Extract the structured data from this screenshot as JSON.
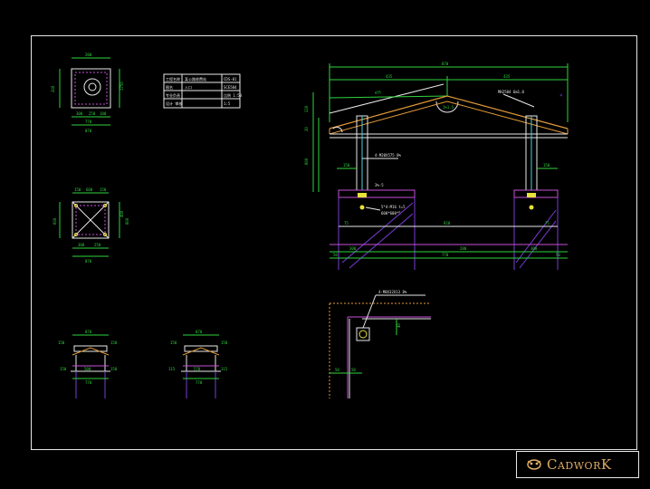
{
  "colors": {
    "background": "#000000",
    "frame": "#e6e6e6",
    "line_white": "#e8e8e8",
    "dim_green": "#2fd33c",
    "cyan": "#42d6e6",
    "magenta": "#c64fd8",
    "purple": "#7a3bd6",
    "yellow": "#e9e23a",
    "orange": "#e39a3a",
    "brand": "#e0ac63"
  },
  "logo": {
    "text": "CadworK",
    "icon": "cadwork-logo-icon"
  },
  "plan_top": {
    "top_dims": [
      "150",
      "200",
      "150"
    ],
    "mid_dims": [
      "300",
      "250",
      "180"
    ],
    "bottom_dim": "770",
    "overall": "870",
    "side_dims": [
      "150",
      "200",
      "150"
    ],
    "right_dims": [
      "250",
      "1750",
      "300"
    ]
  },
  "plan_middle": {
    "top_dims": [
      "150",
      "600",
      "150"
    ],
    "bottom_dims": [
      "300",
      "250"
    ],
    "overall": "870",
    "side_dims": [
      "150",
      "600",
      "150"
    ],
    "right_dims": [
      "400",
      "800"
    ]
  },
  "elev_left": {
    "top": "870",
    "mid_dims": [
      "150",
      "600",
      "150"
    ],
    "row2": [
      "150",
      "500",
      "150"
    ],
    "bottom": "770"
  },
  "elev_right": {
    "top": "870",
    "mid_dims": [
      "150",
      "600",
      "150"
    ],
    "row2": [
      "115",
      "570",
      "115"
    ],
    "bottom": "770"
  },
  "table": {
    "rows": [
      [
        "工程名称",
        "某公路收费站",
        "CDS-01"
      ],
      [
        "图名",
        "入口",
        "SCE504"
      ],
      [
        "专业负责",
        "",
        "比例 1:50"
      ],
      [
        "设计 审核",
        "",
        "1:5"
      ]
    ]
  },
  "main_section": {
    "top_overall": "870",
    "top_dims": [
      "435",
      "435"
    ],
    "beam_label": "MH2504 6m1.8",
    "slope_label": "1%1.5",
    "left_dims": [
      "220",
      "20",
      "800",
      "700"
    ],
    "col_note": "4-M20X575 8%",
    "col_dim_left": "150",
    "col_dim_right": "150",
    "note_b": "3%-5",
    "anchor_note_1": "5*4-M16 t=5",
    "anchor_note_2": "600*600*5",
    "base_dims": [
      "75",
      "920",
      "75"
    ],
    "bottom_dims": [
      "300",
      "280",
      "300"
    ],
    "bottom_overall": "770",
    "edge_left": "50",
    "edge_right": "50"
  },
  "detail": {
    "note": "4-M8X32X13 8%",
    "dim_v": "40",
    "dim_h": "50",
    "dim_small": "50"
  }
}
